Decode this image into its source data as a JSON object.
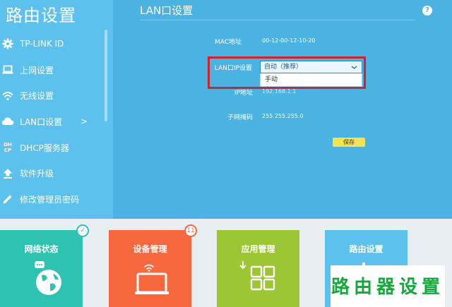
{
  "sidebar": {
    "title": "路由设置",
    "items": [
      {
        "label": "TP-LINK ID",
        "icon": "gear-icon"
      },
      {
        "label": "上网设置",
        "icon": "laptop-icon"
      },
      {
        "label": "无线设置",
        "icon": "wifi-icon"
      },
      {
        "label": "LAN口设置",
        "icon": "cloud-icon",
        "active": true,
        "arrow": ">"
      },
      {
        "label": "DHCP服务器",
        "icon": "dhcp-icon",
        "icon_text": "DH CP"
      },
      {
        "label": "软件升级",
        "icon": "upload-icon"
      },
      {
        "label": "修改管理员密码",
        "icon": "pencil-icon"
      }
    ]
  },
  "main": {
    "title": "LAN口设置",
    "help": "?",
    "fields": {
      "mac_label": "MAC地址",
      "mac_value": "00-12-00-12-10-20",
      "lan_ip_label": "LAN口IP设置",
      "lan_ip_selected": "自动（推荐）",
      "lan_ip_options": [
        "手动"
      ],
      "ip_label": "IP地址",
      "ip_value": "192.168.1.1",
      "mask_label": "子网掩码",
      "mask_value": "255.255.255.0"
    },
    "save_label": "保存"
  },
  "tiles": [
    {
      "label": "网络状态",
      "color": "#2ec3b1",
      "badge": "✓",
      "icon": "globe-icon"
    },
    {
      "label": "设备管理",
      "color": "#f7683f",
      "badge": "11",
      "icon": "devices-icon"
    },
    {
      "label": "应用管理",
      "color": "#9cc634",
      "icon": "apps-icon"
    },
    {
      "label": "路由设置",
      "color": "#5cc1ec",
      "icon": "router-icon"
    }
  ],
  "watermark": "路由器设置",
  "colors": {
    "main_bg": "#4bb3e1",
    "sidebar_bg": "#5cc1ec",
    "highlight": "#d2232a",
    "save_button": "#f7e34f"
  }
}
